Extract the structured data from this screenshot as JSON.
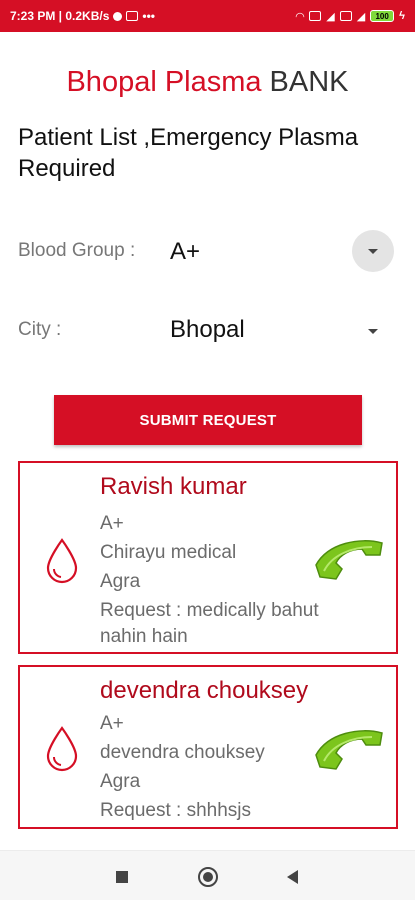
{
  "status_bar": {
    "time": "7:23 PM | 0.2KB/s",
    "battery": "100"
  },
  "header": {
    "title_part1": "Bhopal Plasma",
    "title_part2": "BANK"
  },
  "subtitle": "Patient List ,Emergency Plasma Required",
  "filters": {
    "blood_group_label": "Blood Group :",
    "blood_group_value": "A+",
    "city_label": "City :",
    "city_value": "Bhopal"
  },
  "submit_label": "SUBMIT REQUEST",
  "patients": [
    {
      "name": "Ravish kumar",
      "blood_group": "A+",
      "hospital": "Chirayu medical",
      "city": "Agra",
      "request": "Request : medically bahut",
      "request_cont": "nahin hain"
    },
    {
      "name": "devendra chouksey",
      "blood_group": "A+",
      "hospital": "devendra chouksey",
      "city": "Agra",
      "request": "Request : shhhsjs"
    }
  ],
  "colors": {
    "accent": "#d50f25",
    "name_red": "#b00a1c",
    "phone_green": "#7cc51c"
  },
  "icons": {
    "drop": "blood-drop-icon",
    "phone": "phone-call-icon"
  }
}
